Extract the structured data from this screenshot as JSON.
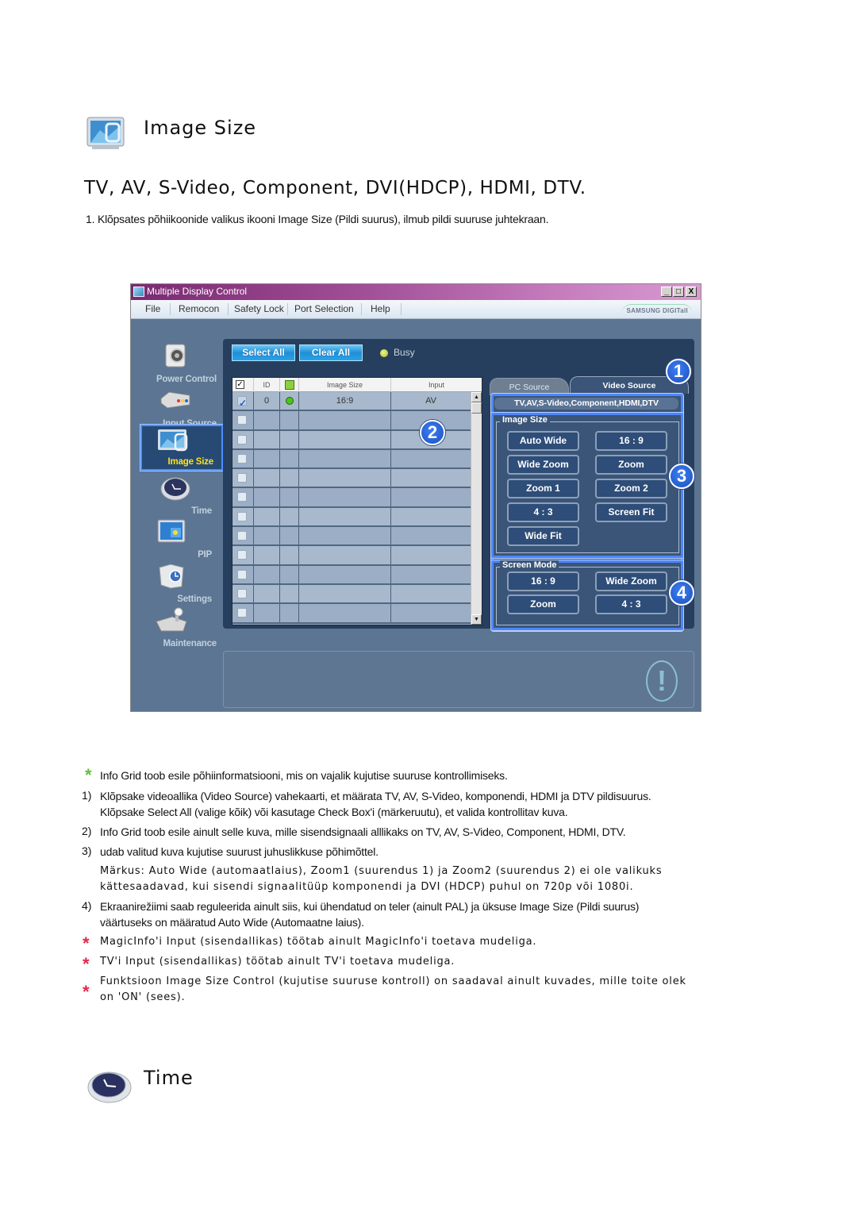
{
  "section_image_size": {
    "icon": "image-size-icon",
    "title": "Image Size",
    "subheading": "TV, AV, S-Video, Component, DVI(HDCP), HDMI, DTV.",
    "step1": "1.  Klõpsates põhiikoonide valikus ikooni Image Size (Pildi suurus), ilmub pildi suuruse juhtekraan."
  },
  "window": {
    "title": "Multiple Display Control",
    "controls": [
      "_",
      "□",
      "X"
    ],
    "menu": [
      "File",
      "Remocon",
      "Safety Lock",
      "Port Selection",
      "Help"
    ],
    "brand": "SAMSUNG DIGITall",
    "nav": [
      {
        "label": "Power Control",
        "icon": "power-control-icon",
        "active": false
      },
      {
        "label": "Input Source",
        "icon": "input-source-icon",
        "active": false
      },
      {
        "label": "Image Size",
        "icon": "image-size-icon",
        "active": true
      },
      {
        "label": "Time",
        "icon": "clock-icon",
        "active": false
      },
      {
        "label": "PIP",
        "icon": "pip-icon",
        "active": false
      },
      {
        "label": "Settings",
        "icon": "settings-icon",
        "active": false
      },
      {
        "label": "Maintenance",
        "icon": "maintenance-icon",
        "active": false
      }
    ],
    "toolbar": {
      "select_all": "Select All",
      "clear_all": "Clear All",
      "busy_label": "Busy"
    },
    "grid": {
      "columns": [
        "",
        "ID",
        "",
        "Image Size",
        "Input"
      ],
      "rows": [
        {
          "checked": true,
          "id": "0",
          "status": "on",
          "image_size": "16:9",
          "input": "AV"
        },
        {
          "checked": false,
          "id": "",
          "status": "",
          "image_size": "",
          "input": ""
        },
        {
          "checked": false,
          "id": "",
          "status": "",
          "image_size": "",
          "input": ""
        },
        {
          "checked": false,
          "id": "",
          "status": "",
          "image_size": "",
          "input": ""
        },
        {
          "checked": false,
          "id": "",
          "status": "",
          "image_size": "",
          "input": ""
        },
        {
          "checked": false,
          "id": "",
          "status": "",
          "image_size": "",
          "input": ""
        },
        {
          "checked": false,
          "id": "",
          "status": "",
          "image_size": "",
          "input": ""
        },
        {
          "checked": false,
          "id": "",
          "status": "",
          "image_size": "",
          "input": ""
        },
        {
          "checked": false,
          "id": "",
          "status": "",
          "image_size": "",
          "input": ""
        },
        {
          "checked": false,
          "id": "",
          "status": "",
          "image_size": "",
          "input": ""
        },
        {
          "checked": false,
          "id": "",
          "status": "",
          "image_size": "",
          "input": ""
        },
        {
          "checked": false,
          "id": "",
          "status": "",
          "image_size": "",
          "input": ""
        }
      ]
    },
    "tabs": {
      "pc_source": "PC Source",
      "video_source": "Video Source",
      "active": "video_source"
    },
    "video_source_banner": "TV,AV,S-Video,Component,HDMI,DTV",
    "image_size_group": {
      "label": "Image Size",
      "buttons": [
        "Auto Wide",
        "16 : 9",
        "Wide Zoom",
        "Zoom",
        "Zoom 1",
        "Zoom 2",
        "4 : 3",
        "Screen Fit",
        "Wide Fit"
      ]
    },
    "screen_mode_group": {
      "label": "Screen Mode",
      "buttons": [
        "16 : 9",
        "Wide Zoom",
        "Zoom",
        "4 : 3"
      ]
    },
    "callouts": [
      "1",
      "2",
      "3",
      "4"
    ],
    "accent_color": "#4d86ff"
  },
  "notes": {
    "intro": "Info Grid toob esile põhiinformatsiooni, mis on vajalik kujutise suuruse kontrollimiseks.",
    "items": [
      {
        "num": "1)",
        "lines": [
          "Klõpsake videoallika (Video Source) vahekaarti, et määrata TV, AV, S-Video, komponendi, HDMI ja DTV pildisuurus.",
          "Klõpsake Select All (valige kõik) või kasutage Check Box'i (märkeruutu), et valida kontrollitav kuva."
        ]
      },
      {
        "num": "2)",
        "lines": [
          "Info Grid toob esile ainult selle kuva, mille sisendsignaali alllikaks on TV, AV, S-Video, Component, HDMI, DTV."
        ]
      },
      {
        "num": "3)",
        "lines": [
          "udab valitud kuva kujutise suurust juhuslikkuse põhimõttel."
        ]
      },
      {
        "num": "",
        "lines": [
          "Märkus: Auto Wide (automaatlaius), Zoom1 (suurendus 1) ja Zoom2 (suurendus 2) ei ole valikuks",
          "kättesaadavad, kui sisendi signaalitüüp komponendi ja DVI (HDCP) puhul on 720p või 1080i."
        ]
      },
      {
        "num": "4)",
        "lines": [
          "Ekraanirežiimi saab reguleerida ainult siis, kui ühendatud on teler (ainult PAL) ja üksuse Image Size (Pildi suurus)",
          "väärtuseks on määratud Auto Wide (Automaatne laius)."
        ]
      }
    ],
    "warnings": [
      "MagicInfo'i Input (sisendallikas) töötab ainult MagicInfo'i toetava mudeliga.",
      "TV'i Input (sisendallikas) töötab ainult TV'i toetava mudeliga.",
      "Funktsioon Image Size Control (kujutise suuruse kontroll) on saadaval ainult kuvades, mille toite olek",
      "on 'ON' (sees)."
    ],
    "star_colors": {
      "green": "#5dc23a",
      "red": "#e8264b"
    }
  },
  "section_time": {
    "icon": "clock-icon",
    "title": "Time"
  }
}
